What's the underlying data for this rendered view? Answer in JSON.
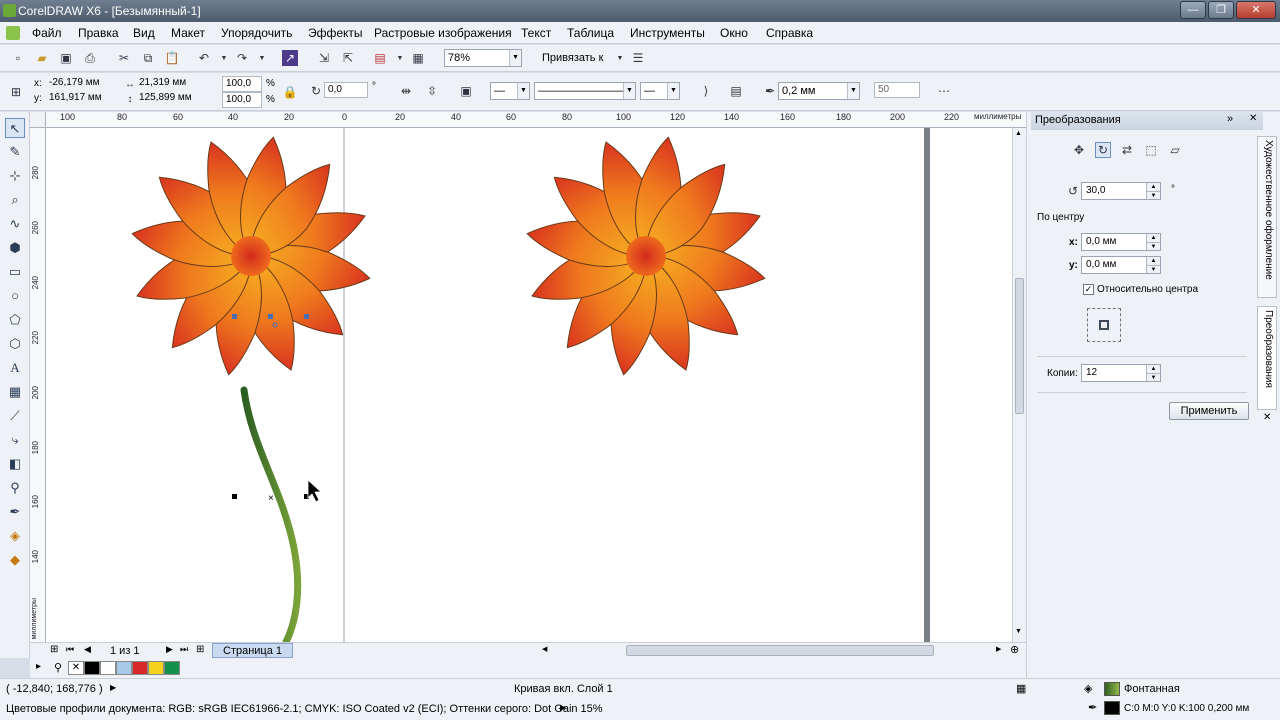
{
  "window": {
    "title": "CorelDRAW X6 - [Безымянный-1]",
    "min": "—",
    "max": "❐",
    "close": "✕"
  },
  "menu": [
    "Файл",
    "Правка",
    "Вид",
    "Макет",
    "Упорядочить",
    "Эффекты",
    "Растровые изображения",
    "Текст",
    "Таблица",
    "Инструменты",
    "Окно",
    "Справка"
  ],
  "standard_toolbar": {
    "zoom": "78%",
    "snap_label": "Привязать к"
  },
  "property_bar": {
    "x_label": "x:",
    "x_value": "-26,179 мм",
    "y_label": "y:",
    "y_value": "161,917 мм",
    "width_value": "21,319 мм",
    "height_value": "125,899 мм",
    "scale_x": "100,0",
    "scale_y": "100,0",
    "percent": "%",
    "rotation": "0,0",
    "degree": "°",
    "outline_width": "0,2 мм",
    "nudge": "50"
  },
  "rulers": {
    "unit": "миллиметры",
    "h_ticks": [
      "100",
      "80",
      "60",
      "40",
      "20",
      "0",
      "20",
      "40",
      "60",
      "80",
      "100",
      "120",
      "140",
      "160",
      "180",
      "200",
      "220"
    ],
    "v_ticks": [
      "280",
      "260",
      "240",
      "220",
      "200",
      "180",
      "160",
      "140"
    ]
  },
  "pagebar": {
    "page_count": "1 из 1",
    "page_tab": "Страница 1"
  },
  "palette": {
    "colors": [
      "#000000",
      "#ffffff",
      "#a8c8e8",
      "#d8282a",
      "#f4d21e",
      "#12914b"
    ]
  },
  "docker": {
    "title": "Преобразования",
    "rotation_value": "30,0",
    "degree": "°",
    "center_label": "По центру",
    "x_label": "x:",
    "x_value": "0,0 мм",
    "y_label": "y:",
    "y_value": "0,0 мм",
    "relative_label": "Относительно центра",
    "copies_label": "Копии:",
    "copies_value": "12",
    "apply_label": "Применить",
    "side_tab_1": "Художественное оформление",
    "side_tab_2": "Преобразования"
  },
  "status": {
    "coords": "( -12,840; 168,776 )",
    "selection": "Кривая вкл. Слой 1",
    "fill_label": "Фонтанная",
    "color_profiles": "Цветовые профили документа: RGB: sRGB IEC61966-2.1; CMYK: ISO Coated v2 (ECI); Оттенки серого: Dot Gain 15%",
    "outline_info": "C:0 M:0 Y:0 K:100  0,200 мм"
  }
}
